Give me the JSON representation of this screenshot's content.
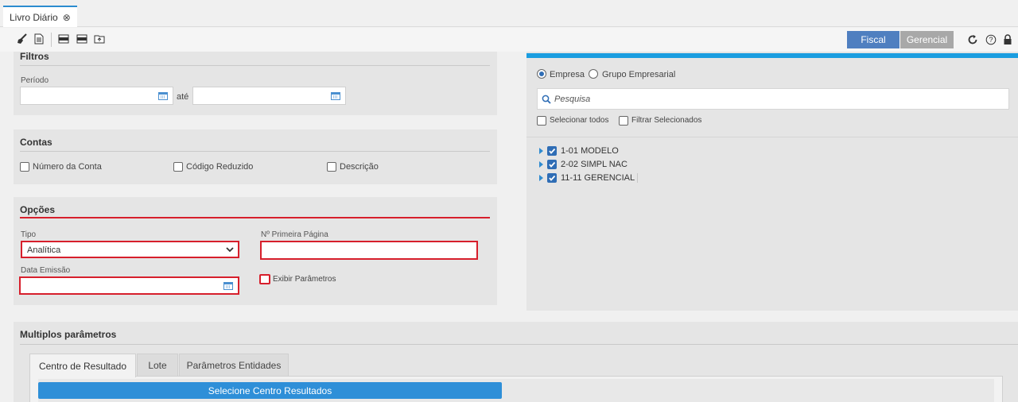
{
  "tab": {
    "title": "Livro Diário"
  },
  "toolbar": {
    "icons": [
      "broom-icon",
      "document-icon",
      "csv-export-icon",
      "pdf-export-icon",
      "upload-icon"
    ],
    "segmented": {
      "fiscal": "Fiscal",
      "gerencial": "Gerencial",
      "active": "Fiscal"
    },
    "right_icons": [
      "refresh-icon",
      "help-icon",
      "lock-icon"
    ]
  },
  "filtros": {
    "title": "Filtros",
    "periodo_label": "Período",
    "ate_label": "até",
    "start_value": "",
    "end_value": ""
  },
  "contas": {
    "title": "Contas",
    "options": [
      {
        "label": "Número da Conta",
        "checked": false
      },
      {
        "label": "Código Reduzido",
        "checked": false
      },
      {
        "label": "Descrição",
        "checked": false
      }
    ]
  },
  "opcoes": {
    "title": "Opções",
    "tipo_label": "Tipo",
    "tipo_value": "Analítica",
    "primeira_pagina_label": "Nº Primeira Página",
    "primeira_pagina_value": "",
    "data_emissao_label": "Data Emissão",
    "data_emissao_value": "",
    "exibir_parametros_label": "Exibir Parâmetros",
    "exibir_parametros_checked": false
  },
  "empresas": {
    "radio_empresa": "Empresa",
    "radio_grupo": "Grupo Empresarial",
    "selected": "Empresa",
    "search_placeholder": "Pesquisa",
    "selecionar_todos": "Selecionar todos",
    "filtrar_selecionados": "Filtrar Selecionados",
    "items": [
      {
        "label": "1-01 MODELO",
        "checked": true
      },
      {
        "label": "2-02 SIMPL NAC",
        "checked": true
      },
      {
        "label": "11-11 GERENCIAL",
        "checked": true
      }
    ]
  },
  "multiplos": {
    "title": "Multiplos parâmetros",
    "tabs": [
      "Centro de Resultado",
      "Lote",
      "Parâmetros Entidades"
    ],
    "active_tab": "Centro de Resultado",
    "button": "Selecione Centro Resultados"
  },
  "colors": {
    "accent": "#2e8fd8",
    "error": "#d71f2c",
    "fiscal": "#4f7fc0"
  }
}
